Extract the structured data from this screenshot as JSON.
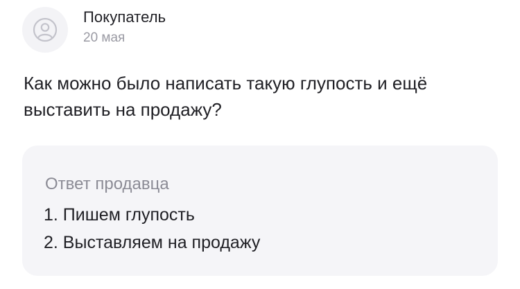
{
  "review": {
    "author": "Покупатель",
    "date": "20 мая",
    "avatar_icon": "user-icon",
    "text": "Как можно было написать такую глупость и ещё выставить на продажу?"
  },
  "seller_answer": {
    "title": "Ответ продавца",
    "lines": [
      "1. Пишем глупость",
      "2. Выставляем на продажу"
    ]
  }
}
